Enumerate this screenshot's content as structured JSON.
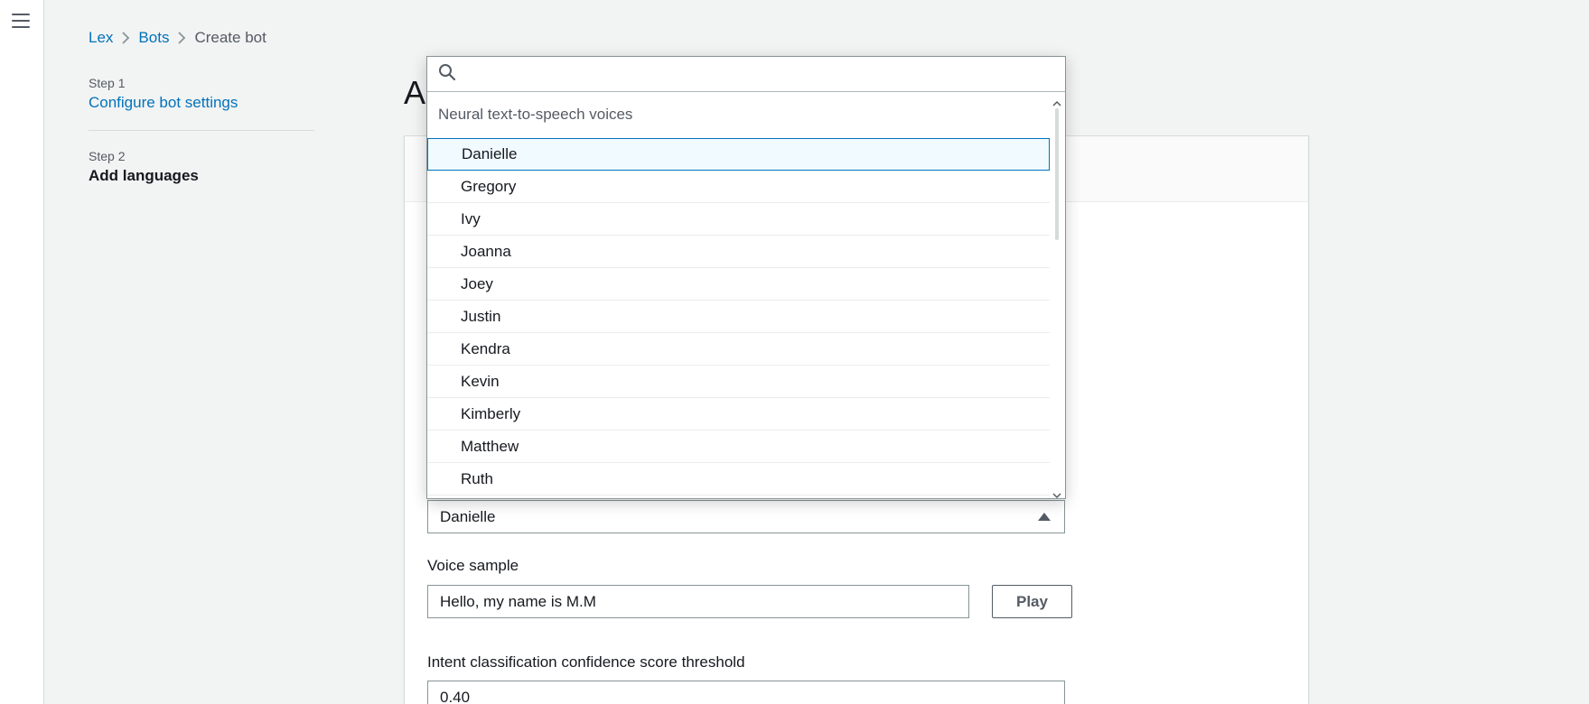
{
  "breadcrumb": {
    "items": [
      "Lex",
      "Bots"
    ],
    "current": "Create bot"
  },
  "steps": [
    {
      "number": "Step 1",
      "label": "Configure bot settings"
    },
    {
      "number": "Step 2",
      "label": "Add languages"
    }
  ],
  "page": {
    "heading_visible": "A"
  },
  "voice_dropdown": {
    "search_value": "",
    "group_label": "Neural text-to-speech voices",
    "options": [
      "Danielle",
      "Gregory",
      "Ivy",
      "Joanna",
      "Joey",
      "Justin",
      "Kendra",
      "Kevin",
      "Kimberly",
      "Matthew",
      "Ruth"
    ],
    "selected": "Danielle"
  },
  "voice_sample": {
    "label": "Voice sample",
    "value": "Hello, my name is M.M",
    "play_label": "Play"
  },
  "confidence": {
    "label": "Intent classification confidence score threshold",
    "value": "0.40"
  },
  "colors": {
    "link": "#0073bb",
    "selected_bg": "#f1faff",
    "page_bg": "#f2f3f3"
  }
}
